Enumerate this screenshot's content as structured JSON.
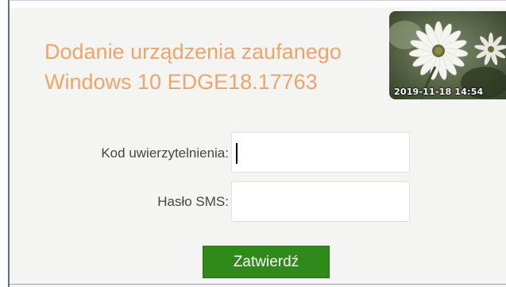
{
  "header": {
    "title_line1": "Dodanie urządzenia zaufanego",
    "title_line2": "Windows 10 EDGE18.17763"
  },
  "photo": {
    "timestamp": "2019-11-18 14:54",
    "icon": "daisy-flower-image"
  },
  "form": {
    "code_label": "Kod uwierzytelnienia:",
    "code_value": "",
    "sms_label": "Hasło SMS:",
    "sms_value": "",
    "submit_label": "Zatwierdź"
  },
  "colors": {
    "title": "#f0a46a",
    "submit_bg": "#2f8a1a",
    "card_bg": "#f4f4f2"
  }
}
